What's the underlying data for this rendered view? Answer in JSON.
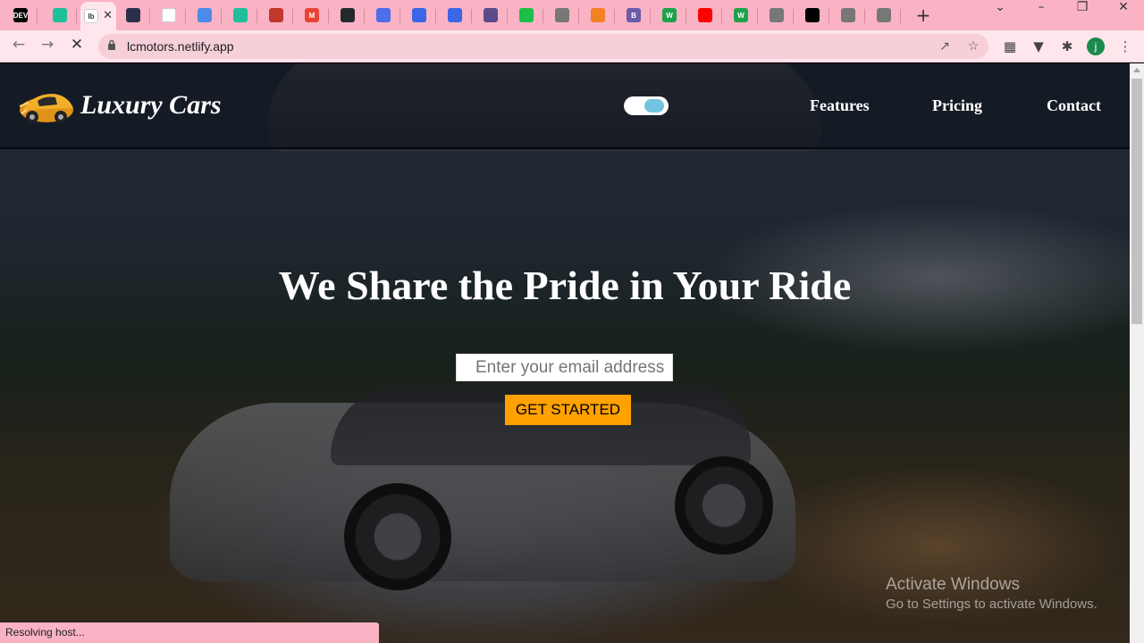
{
  "browser": {
    "tabs": [
      {
        "icon": "dev-icon",
        "color": "#000000",
        "text": "DEV"
      },
      {
        "icon": "diamond-icon",
        "color": "#1fbf9a",
        "text": ""
      },
      {
        "icon": "page-icon",
        "color": "#ffffff",
        "text": "Ib",
        "active": true
      },
      {
        "icon": "camera-icon",
        "color": "#2b2f4a",
        "text": ""
      },
      {
        "icon": "note-icon",
        "color": "#ffffff",
        "text": ""
      },
      {
        "icon": "flag-icon",
        "color": "#4d8be8",
        "text": ""
      },
      {
        "icon": "diamond-icon",
        "color": "#1fbf9a",
        "text": ""
      },
      {
        "icon": "pdf-icon",
        "color": "#c0392b",
        "text": ""
      },
      {
        "icon": "gmail-icon",
        "color": "#ea4335",
        "text": "M"
      },
      {
        "icon": "github-icon",
        "color": "#24292e",
        "text": ""
      },
      {
        "icon": "play-icon",
        "color": "#4f6ee8",
        "text": ""
      },
      {
        "icon": "circle-icon",
        "color": "#3b66e8",
        "text": ""
      },
      {
        "icon": "circle-icon",
        "color": "#3b66e8",
        "text": ""
      },
      {
        "icon": "coolors-icon",
        "color": "#5b4b8a",
        "text": ""
      },
      {
        "icon": "check-icon",
        "color": "#1bbf48",
        "text": ""
      },
      {
        "icon": "globe-icon",
        "color": "#777777",
        "text": ""
      },
      {
        "icon": "stack-icon",
        "color": "#f48024",
        "text": ""
      },
      {
        "icon": "bold-icon",
        "color": "#6b5ba8",
        "text": "B"
      },
      {
        "icon": "w-icon",
        "color": "#1ca24a",
        "text": "W"
      },
      {
        "icon": "youtube-icon",
        "color": "#ff0000",
        "text": ""
      },
      {
        "icon": "w-icon",
        "color": "#1ca24a",
        "text": "W"
      },
      {
        "icon": "globe-icon",
        "color": "#777777",
        "text": ""
      },
      {
        "icon": "a-icon",
        "color": "#000000",
        "text": ""
      },
      {
        "icon": "globe-icon",
        "color": "#777777",
        "text": ""
      },
      {
        "icon": "globe-icon",
        "color": "#777777",
        "text": ""
      }
    ],
    "new_tab": "+",
    "url": "lcmotors.netlify.app",
    "profile_initial": "j",
    "status": "Resolving host..."
  },
  "navbar": {
    "brand": "Luxury Cars",
    "links": [
      "Features",
      "Pricing",
      "Contact"
    ]
  },
  "hero": {
    "title": "We Share the Pride in Your Ride",
    "email_placeholder": "Enter your email address",
    "cta": "GET STARTED"
  },
  "watermark": {
    "line1": "Activate Windows",
    "line2": "Go to Settings to activate Windows."
  }
}
